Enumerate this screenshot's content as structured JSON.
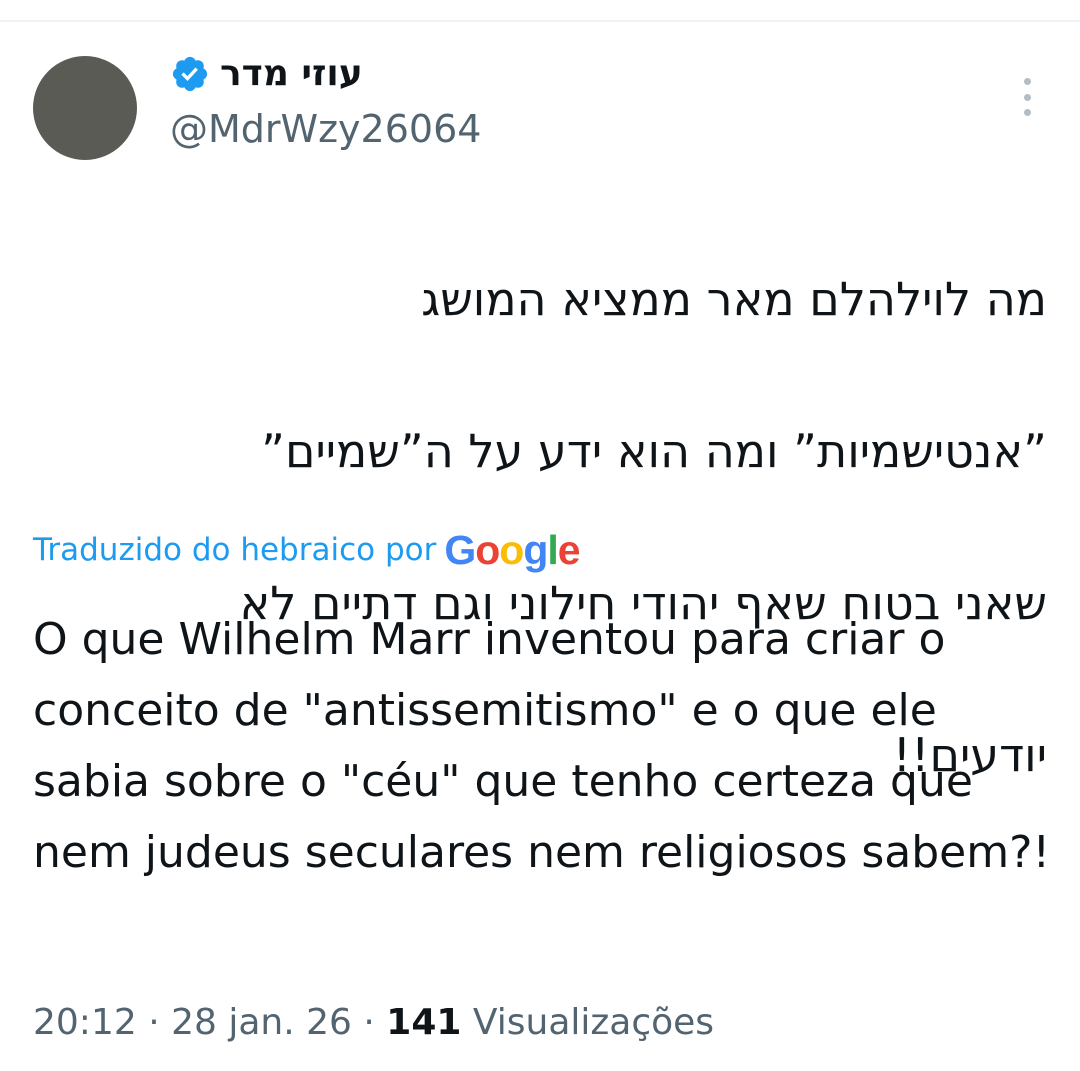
{
  "tweet": {
    "author": {
      "display_name": "עוזי מדר",
      "handle": "@MdrWzy26064",
      "verified": true
    },
    "text_lines": [
      "מה לוילהלם מאר ממציא המושג",
      "”אנטישמיות” ומה הוא ידע על ה”שמיים”",
      "שאני בטוח שאף יהודי חילוני וגם דתיים לא",
      "יודעים!!"
    ],
    "translation_label": "Traduzido do hebraico por",
    "translation_provider": "Google",
    "translation_text": "O que Wilhelm Marr inventou para criar o conceito de \"antissemitismo\" e o que ele sabia sobre o \"céu\" que tenho certeza que nem judeus seculares nem religiosos sabem?!",
    "time": "20:12",
    "separator": "·",
    "date": "28 jan. 26",
    "views_count": "141",
    "views_label": "Visualizações"
  },
  "colors": {
    "accent": "#1d9bf0",
    "secondary_text": "#536471",
    "primary_text": "#0f1419",
    "google_blue": "#4285F4",
    "google_red": "#EA4335",
    "google_yellow": "#FBBC05",
    "google_green": "#34A853"
  },
  "icons": {
    "verified": "verified-badge-icon",
    "more": "more-vertical-icon"
  }
}
